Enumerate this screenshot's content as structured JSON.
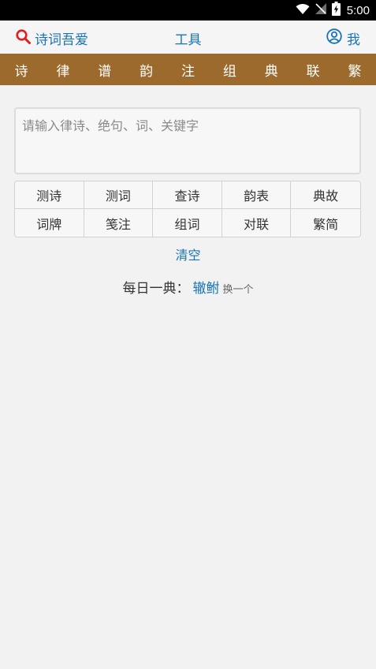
{
  "status_bar": {
    "time": "5:00"
  },
  "header": {
    "app_name": "诗词吾爱",
    "title": "工具",
    "profile_label": "我"
  },
  "nav": {
    "items": [
      "诗",
      "律",
      "谱",
      "韵",
      "注",
      "组",
      "典",
      "联",
      "繁"
    ]
  },
  "search": {
    "placeholder": "请输入律诗、绝句、词、关键字",
    "value": ""
  },
  "tools": {
    "items": [
      "测诗",
      "测词",
      "查诗",
      "韵表",
      "典故",
      "词牌",
      "笺注",
      "组词",
      "对联",
      "繁简"
    ]
  },
  "clear_label": "清空",
  "daily": {
    "label": "每日一典：",
    "word": "辙鲋",
    "switch_label": "换一个"
  },
  "colors": {
    "accent": "#1a73b5",
    "nav_bg": "#9b6a2c",
    "search_icon": "#e02020"
  }
}
